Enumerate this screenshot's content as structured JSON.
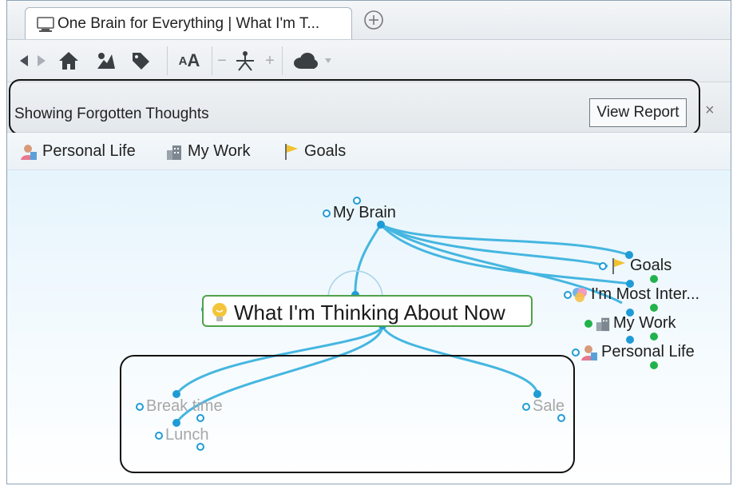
{
  "tab": {
    "title": "One Brain for Everything | What I'm T..."
  },
  "toolbar": {
    "font_label_small": "A",
    "font_label_large": "A",
    "minus": "−",
    "plus": "+"
  },
  "report_bar": {
    "message": "Showing Forgotten Thoughts",
    "view_report_label": "View Report",
    "close_label": "×"
  },
  "pins": [
    {
      "label": "Personal Life",
      "icon": "person-icon"
    },
    {
      "label": "My Work",
      "icon": "building-icon"
    },
    {
      "label": "Goals",
      "icon": "flag-icon"
    }
  ],
  "map": {
    "parent": "My Brain",
    "active": "What I'm Thinking About Now",
    "jumps": [
      "Goals",
      "I'm Most Inter...",
      "My Work",
      "Personal Life"
    ],
    "children": [
      "Break time",
      "Lunch",
      "Sale"
    ]
  },
  "colors": {
    "link": "#45b6e0",
    "active_border": "#4fa24b",
    "forgotten_text": "#a7a7a7",
    "dot_green": "#22b24c"
  }
}
